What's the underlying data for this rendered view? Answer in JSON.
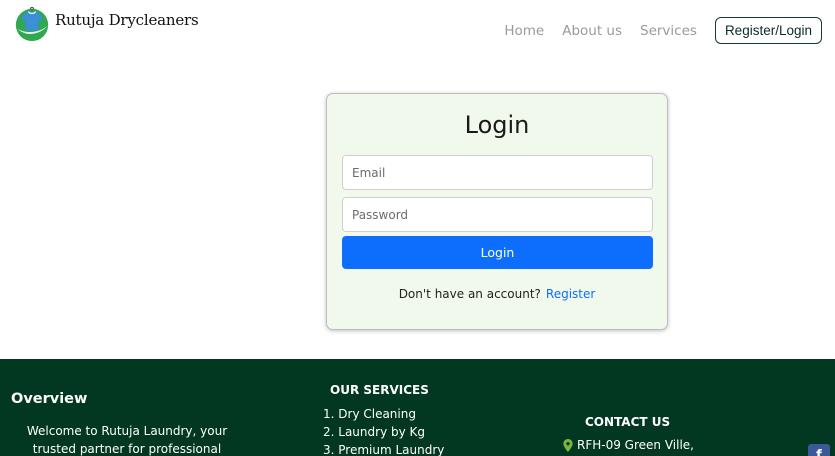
{
  "header": {
    "brand_name": "Rutuja Drycleaners",
    "nav": {
      "home": "Home",
      "about": "About us",
      "services": "Services",
      "register_login": "Register/Login"
    }
  },
  "login": {
    "title": "Login",
    "email_placeholder": "Email",
    "password_placeholder": "Password",
    "submit_label": "Login",
    "no_account_text": "Don't have an account?",
    "register_link": "Register"
  },
  "footer": {
    "overview_title": "Overview",
    "overview_text": "Welcome to Rutuja Laundry, your trusted partner for professional laundry and dry",
    "services_title": "OUR SERVICES",
    "services": [
      "1. Dry Cleaning",
      "2. Laundry by Kg",
      "3. Premium Laundry"
    ],
    "contact_title": "CONTACT US",
    "address": "RFH-09 Green Ville,",
    "facebook_icon_text": "f"
  },
  "colors": {
    "footer_bg": "#023821",
    "card_bg": "#f1f9ec",
    "primary": "#0d6efd",
    "pin_green": "#7cb342",
    "facebook_blue": "#3b5998"
  },
  "icons": [
    "laundry-shirt-logo-icon",
    "map-pin-icon",
    "facebook-icon"
  ]
}
